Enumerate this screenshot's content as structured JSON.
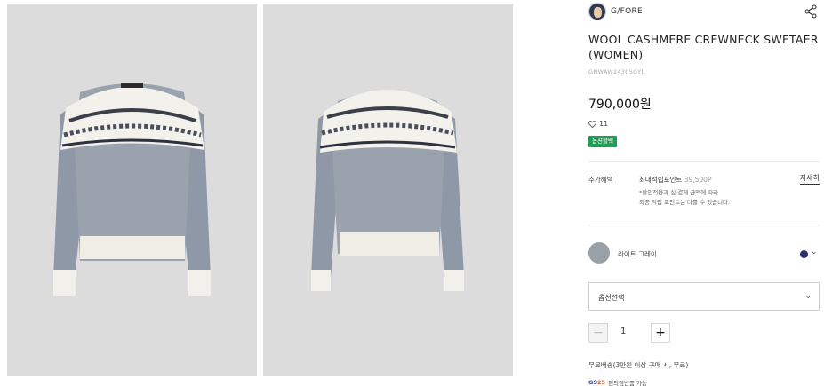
{
  "brand": {
    "name": "G/FORE"
  },
  "product": {
    "title": "WOOL CASHMERE CREWNECK SWETAER (WOMEN)",
    "sku": "GNWAW24305GYL",
    "price": "790,000원",
    "likes": "11",
    "badge": "옵션할백"
  },
  "benefit": {
    "label": "추가혜택",
    "main_prefix": "최대적립포인트",
    "points": "39,500P",
    "note_line1": "*할인적용과 실 결제 금액에 따라",
    "note_line2": "최종 적립 포인트는 다를 수 있습니다.",
    "detail_link": "자세히"
  },
  "color": {
    "name": "라이트 그레이",
    "accent": "#2d2f6b"
  },
  "option": {
    "placeholder": "옵션선택"
  },
  "quantity": {
    "minus": "−",
    "value": "1",
    "plus": "+"
  },
  "shipping": {
    "text": "무료배송(3만원 이상 구매 시, 무료)"
  },
  "gs": {
    "logo_text": "GS",
    "logo_num": "25",
    "text": "편의점반품 가능"
  },
  "icons": [
    "share-icon",
    "heart-icon",
    "chevron-down-icon"
  ]
}
